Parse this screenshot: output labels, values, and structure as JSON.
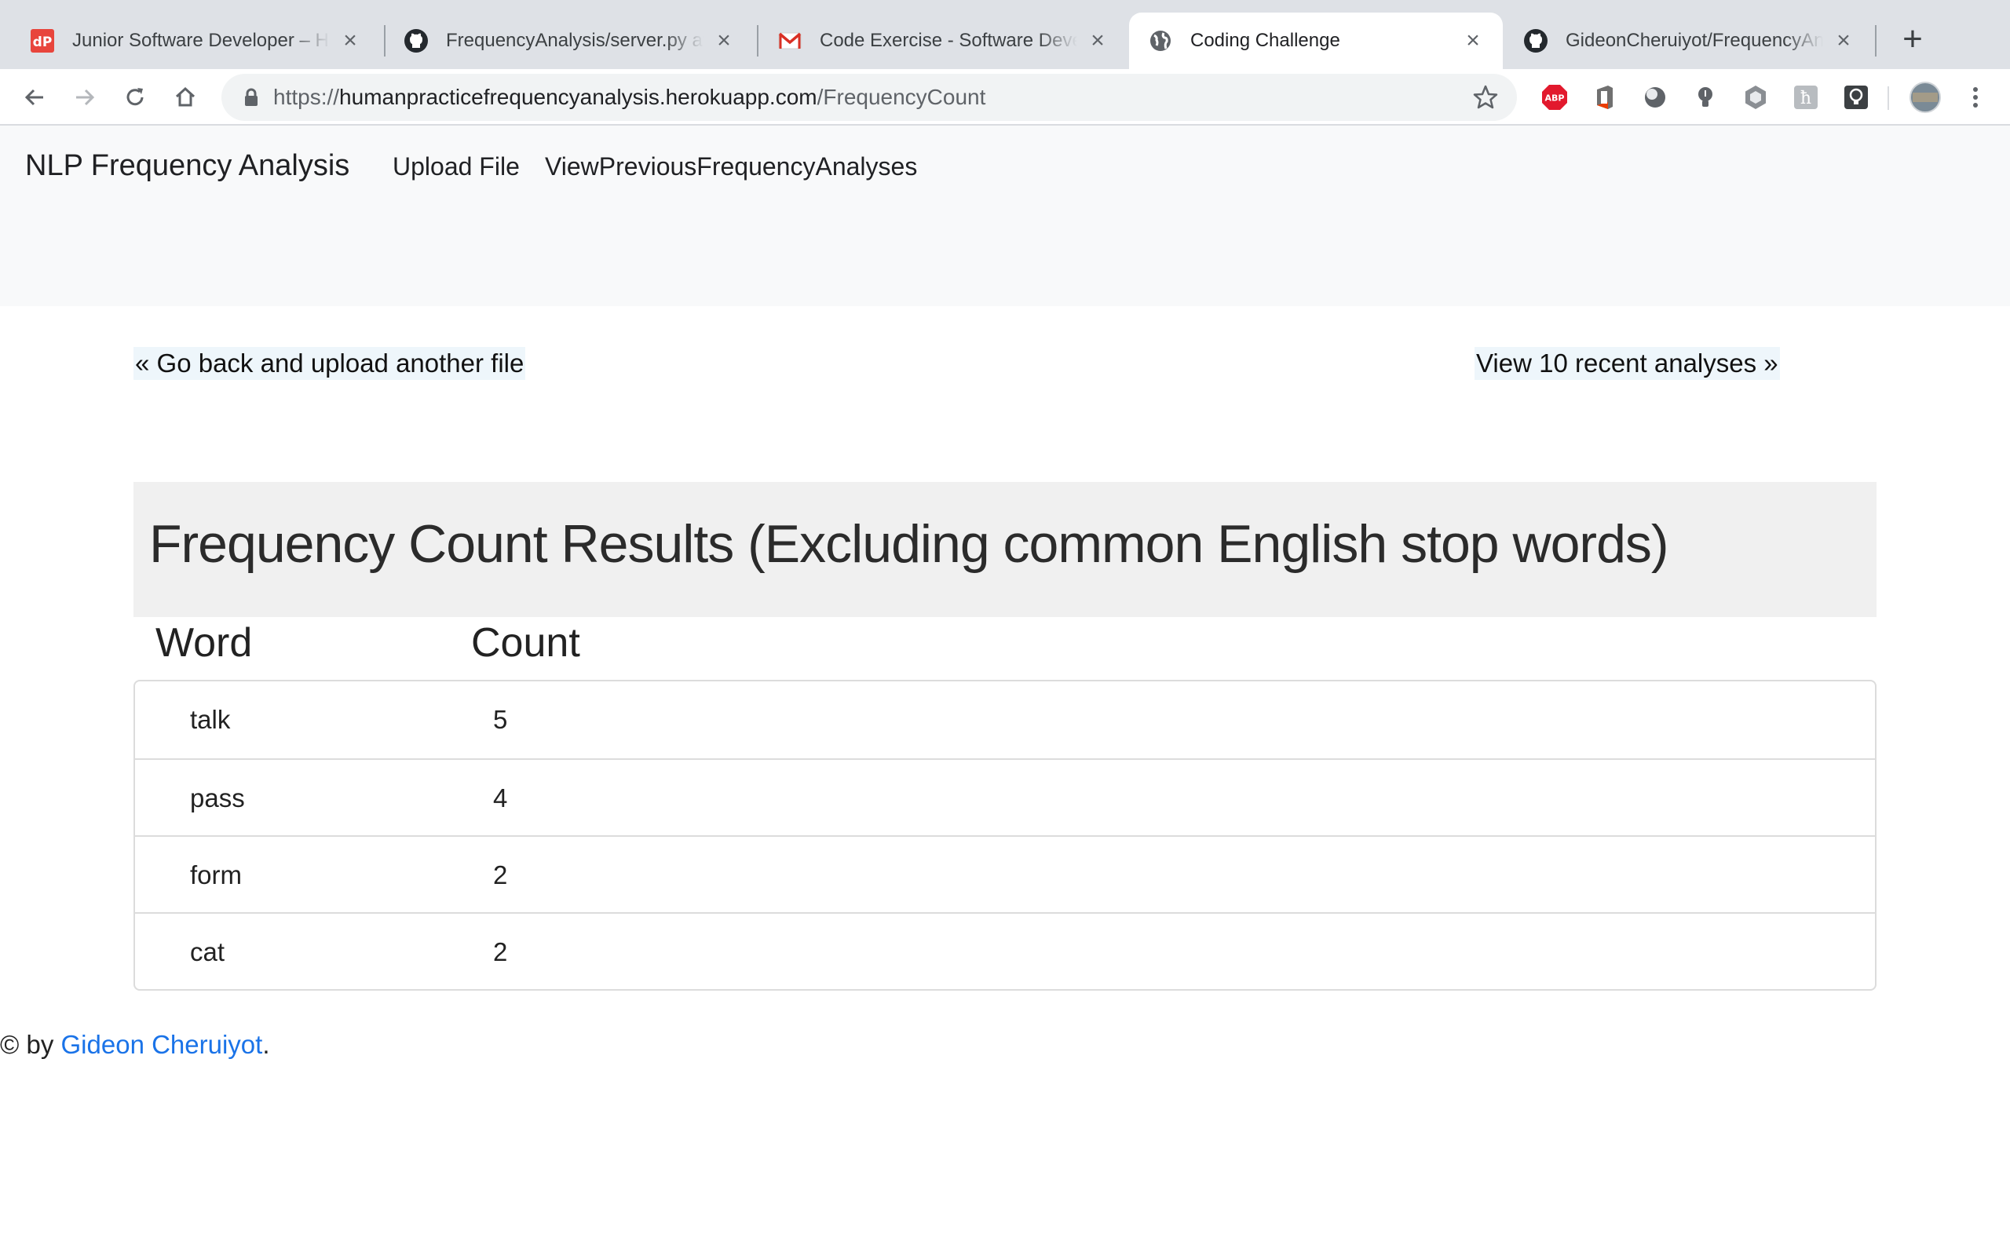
{
  "browser": {
    "tabs": [
      {
        "title": "Junior Software Developer – Human Practice",
        "favicon": "hp-logo-icon",
        "active": false
      },
      {
        "title": "FrequencyAnalysis/server.py at master",
        "favicon": "github-icon",
        "active": false
      },
      {
        "title": "Code Exercise - Software Developer",
        "favicon": "gmail-icon",
        "active": false
      },
      {
        "title": "Coding Challenge",
        "favicon": "globe-icon",
        "active": true
      },
      {
        "title": "GideonCheruiyot/FrequencyAnalysis",
        "favicon": "github-icon",
        "active": false
      }
    ],
    "url": {
      "scheme": "https://",
      "host": "humanpracticefrequencyanalysis.herokuapp.com",
      "path": "/FrequencyCount"
    },
    "extensions": [
      "adblock-plus-icon",
      "office-icon",
      "circle-extension-icon",
      "bulb-extension-icon",
      "hexagon-extension-icon",
      "h-extension-icon",
      "lightbulb-extension-icon",
      "profile-avatar"
    ],
    "colors": {
      "tabstrip": "#dee1e6",
      "adblock": "#e2192d",
      "link": "#1a73e8"
    }
  },
  "navbar": {
    "brand": "NLP Frequency Analysis",
    "links": [
      "Upload File",
      "ViewPreviousFrequencyAnalyses"
    ]
  },
  "pager": {
    "back": "« Go back and upload another file",
    "next": "View 10 recent analyses »"
  },
  "results": {
    "heading": "Frequency Count Results (Excluding common English stop words)",
    "columns": {
      "word": "Word",
      "count": "Count"
    },
    "rows": [
      {
        "word": "talk",
        "count": "5"
      },
      {
        "word": "pass",
        "count": "4"
      },
      {
        "word": "form",
        "count": "2"
      },
      {
        "word": "cat",
        "count": "2"
      }
    ]
  },
  "footer": {
    "prefix": "© by ",
    "author": "Gideon Cheruiyot",
    "suffix": "."
  }
}
